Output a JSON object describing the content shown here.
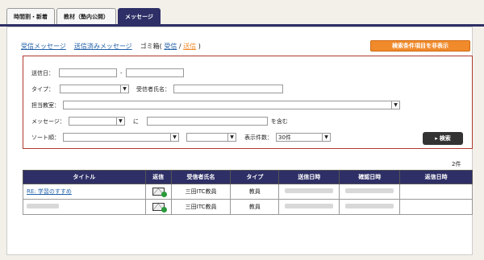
{
  "tabs": [
    {
      "label": "時間割・新着"
    },
    {
      "label": "教材（塾内公開）"
    },
    {
      "label": "メッセージ"
    }
  ],
  "nav": {
    "received": "受信メッセージ",
    "sent": "送信済みメッセージ",
    "trash_prefix": "ゴミ箱(",
    "trash_received": "受信",
    "trash_sep": "/",
    "trash_sent": "送信",
    "trash_suffix": ")"
  },
  "hide_conditions_button": "検索条件項目を非表示",
  "search": {
    "sent_date_label": "送信日：",
    "date_sep": "-",
    "type_label": "タイプ：",
    "receiver_label": "受信者氏名：",
    "subject_label": "担当教室：",
    "message_label": "メッセージ：",
    "ni_label": "に",
    "contains_label": "を含む",
    "sort_label": "ソート順：",
    "display_count_label": "表示件数：",
    "display_count_value": "30件",
    "search_button": "検索"
  },
  "result_count": "2件",
  "table": {
    "headers": [
      "タイトル",
      "返信",
      "受信者氏名",
      "タイプ",
      "送信日時",
      "確認日時",
      "返信日時"
    ],
    "rows": [
      {
        "title": "RE: 学習のすすめ",
        "receiver": "三田ITC教員",
        "type": "教員"
      },
      {
        "title": "",
        "receiver": "三田ITC教員",
        "type": "教員"
      }
    ]
  },
  "colors": {
    "navy": "#2e2f66",
    "orange": "#f08a2a",
    "search_border": "#b03a2e",
    "link": "#1f5fa8"
  }
}
